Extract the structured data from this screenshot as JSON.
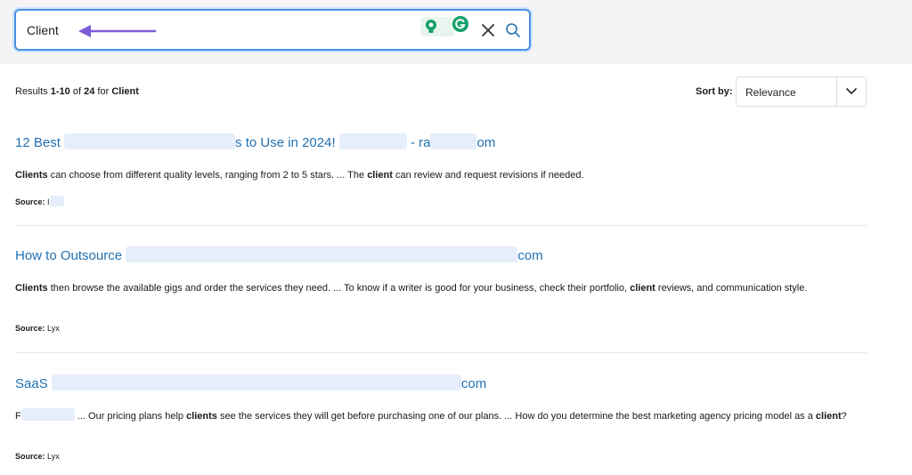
{
  "search": {
    "value": "Client",
    "placeholder": ""
  },
  "summary": {
    "prefix": "Results",
    "range": "1-10",
    "of_word": "of",
    "total": "24",
    "for_word": "for",
    "query": "Client"
  },
  "sort": {
    "label": "Sort by:",
    "value": "Relevance"
  },
  "results": [
    {
      "title_start": "12 Best",
      "title_mid": "s to Use in 2024!",
      "title_sep": "- ra",
      "title_end": "om",
      "snippet": [
        {
          "b": "Clients"
        },
        {
          "t": " can choose from different quality levels, ranging from 2 to 5 stars. ... The "
        },
        {
          "b": "client"
        },
        {
          "t": " can review and request revisions if needed."
        }
      ],
      "source_label": "Source:",
      "source_value": "I"
    },
    {
      "title_start": "How to Outsource",
      "title_end": "com",
      "snippet": [
        {
          "b": "Clients"
        },
        {
          "t": " then browse the available gigs and order the services they need. ... To know if a writer is good for your business, check their portfolio, "
        },
        {
          "b": "client"
        },
        {
          "t": " reviews, and communication style."
        }
      ],
      "source_label": "Source:",
      "source_value": "Lyx"
    },
    {
      "title_start": "SaaS",
      "title_end": "com",
      "snippet": [
        {
          "t": "F"
        },
        {
          "t": " ... Our pricing plans help "
        },
        {
          "b": "clients"
        },
        {
          "t": " see the services they will get before purchasing one of our plans. ... How do you determine the best marketing agency pricing model as a "
        },
        {
          "b": "client"
        },
        {
          "t": "?"
        }
      ],
      "source_label": "Source:",
      "source_value": "Lyx"
    }
  ],
  "colors": {
    "link": "#2271b1",
    "focus_border": "#4a90e2",
    "arrow": "#7b5cd6",
    "topbar": "#f4f4f5"
  },
  "icons": [
    "arrow-annotation-icon",
    "idea-bulb-icon",
    "grammarly-icon",
    "close-icon",
    "search-icon",
    "chevron-down-icon"
  ]
}
